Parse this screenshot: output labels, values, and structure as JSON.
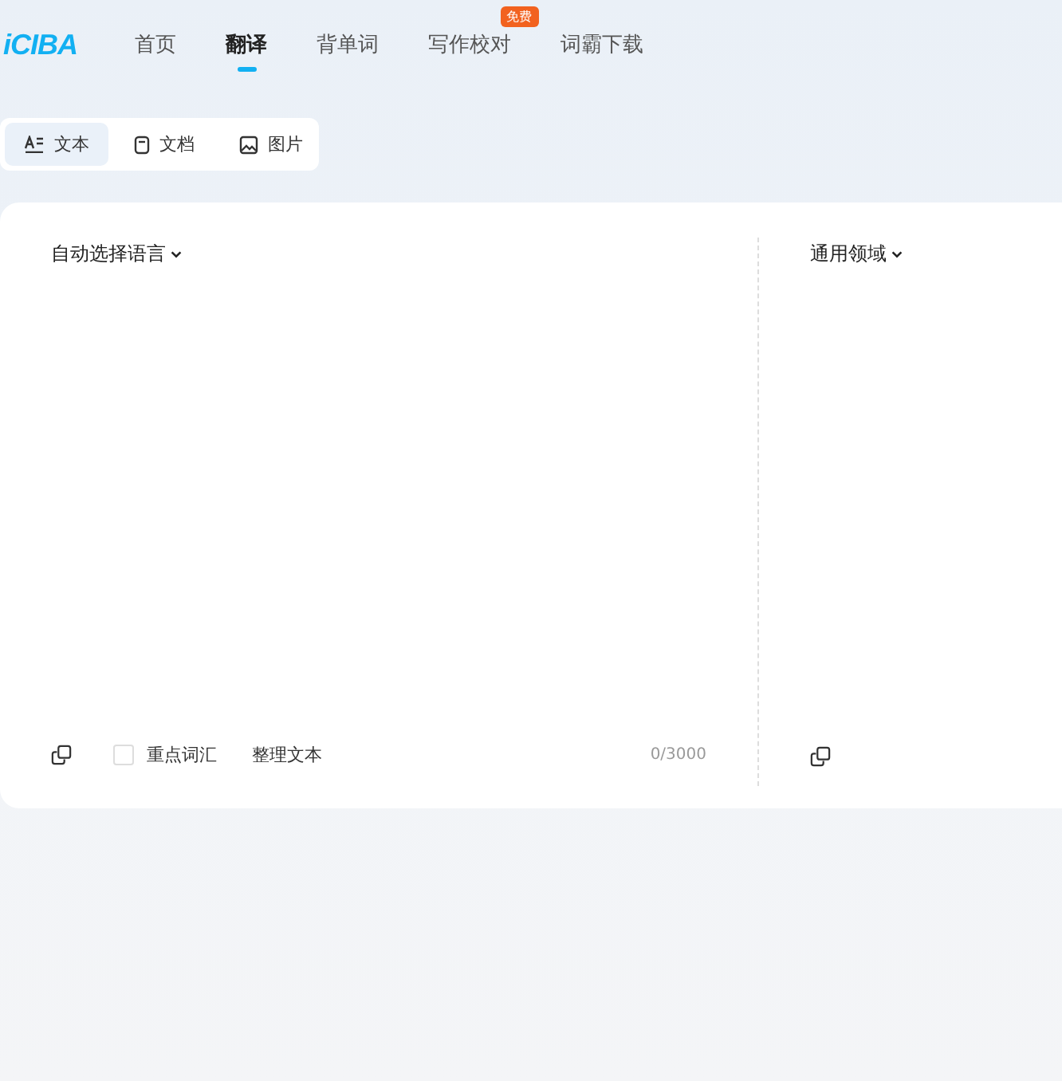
{
  "logo": "iCIBA",
  "nav": [
    {
      "label": "首页",
      "selected": false
    },
    {
      "label": "翻译",
      "selected": true
    },
    {
      "label": "背单词",
      "selected": false
    },
    {
      "label": "写作校对",
      "selected": false,
      "badge": "免费"
    },
    {
      "label": "词霸下载",
      "selected": false
    }
  ],
  "modes": [
    {
      "label": "文本",
      "kind": "text",
      "selected": true
    },
    {
      "label": "文档",
      "kind": "document",
      "selected": false
    },
    {
      "label": "图片",
      "kind": "image",
      "selected": false
    }
  ],
  "source": {
    "language": "自动选择语言",
    "key_words": {
      "label": "重点词汇",
      "checked": false
    },
    "tidy": "整理文本",
    "count": "0/3000"
  },
  "target": {
    "domain": "通用领域"
  }
}
